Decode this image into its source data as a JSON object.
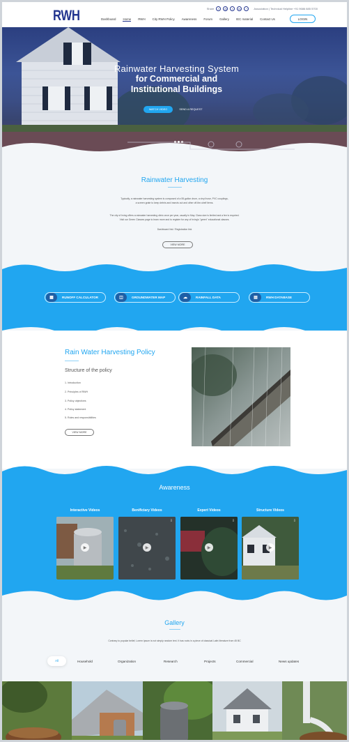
{
  "header": {
    "logo": "RWH",
    "top_links": "Association | Technical Helpline +91 9686 885 5700",
    "share_label": "Share",
    "nav": [
      "Dashboard",
      "Home",
      "RWH",
      "City RWH Policy",
      "Awareness",
      "Forum",
      "Gallery",
      "IEC material",
      "Contact Us"
    ],
    "active_nav": "Home",
    "login_label": "LOGIN"
  },
  "hero": {
    "line1": "Rainwater Harvesting System",
    "line2": "for Commercial and",
    "line3": "Institutional Buildings",
    "btn_watch": "WATCH VIDEO",
    "btn_send": "SEND A REQUEST",
    "slide_count": 3,
    "active_slide": 2
  },
  "rwh": {
    "title": "Rainwater Harvesting",
    "para1a": "Typically, a rainwater harvesting system is composed of a 55-gallon drum, a vinyl hose, PVC couplings,",
    "para1b": "a screen grate to keep debris and insects out and other off-the-shelf items.",
    "para2a": "The city of Irving offers a rainwater harvesting clinic once per year, usually in May. Class size is limited and a fee is required.",
    "para2b": "Visit our Green Classes page to learn more and to register for any of Irving's \"green\" educational classes.",
    "links": "Dashboard link / Registration link",
    "view_more": "VIEW MORE"
  },
  "tools": [
    {
      "label": "RUNOFF CALCULATOR",
      "icon": "calculator-icon"
    },
    {
      "label": "GROUNDWATER MAP",
      "icon": "map-icon"
    },
    {
      "label": "RAINFALL DATA",
      "icon": "cloud-rain-icon"
    },
    {
      "label": "RWH DATABASE",
      "icon": "database-icon"
    }
  ],
  "policy": {
    "title": "Rain Water Harvesting Policy",
    "subtitle": "Structure of the policy",
    "items": [
      "1. Introduction",
      "2. Principles of RWH",
      "3. Policy objectives",
      "4. Policy statement",
      "5. Roles and responsibilities"
    ],
    "view_more": "VIEW MORE"
  },
  "awareness": {
    "title": "Awareness",
    "videos": [
      "Interactive Videos",
      "Benificiary Videos",
      "Expert Videos",
      "Structure Videos"
    ]
  },
  "gallery": {
    "title": "Gallery",
    "text": "Contrary to popular belief, Lorem Ipsum is not simply random text. It has roots in a piece of classical Latin literature from 45 BC",
    "tabs": [
      "All",
      "Household",
      "Organization",
      "Research",
      "Projects",
      "Commercial",
      "News updates"
    ],
    "active_tab": "All"
  },
  "colors": {
    "accent": "#21a6f0",
    "brand": "#23358f"
  }
}
